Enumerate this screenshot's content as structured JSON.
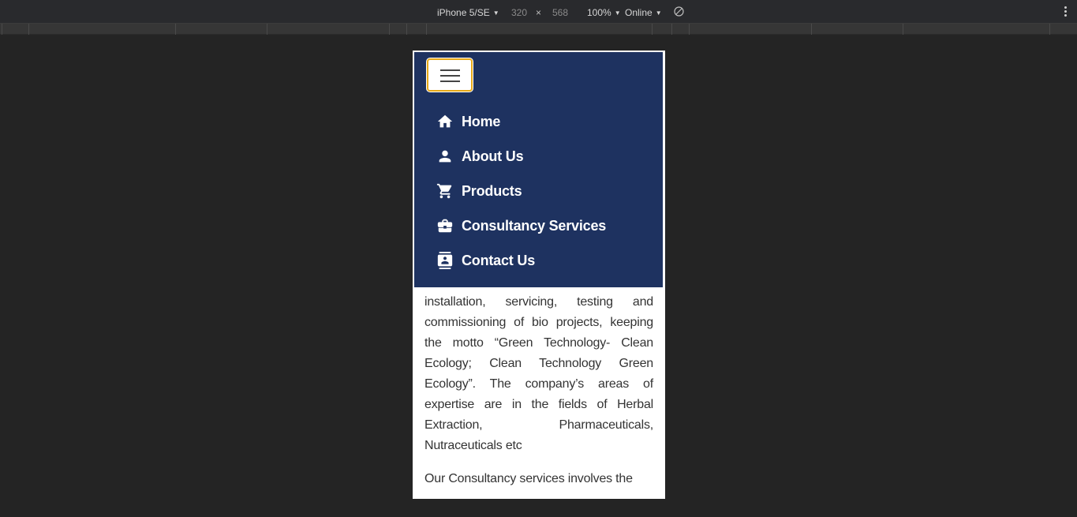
{
  "devtools": {
    "device": "iPhone 5/SE",
    "width": "320",
    "times": "×",
    "height": "568",
    "zoom": "100%",
    "network": "Online",
    "icons": {
      "dropdown": "caret-down-icon",
      "rotate": "rotate-icon",
      "more": "more-vertical-icon"
    }
  },
  "nav": {
    "toggler_icon": "hamburger-menu-icon",
    "items": [
      {
        "label": "Home",
        "icon": "home-icon"
      },
      {
        "label": "About Us",
        "icon": "person-icon"
      },
      {
        "label": "Products",
        "icon": "cart-icon"
      },
      {
        "label": "Consultancy Services",
        "icon": "briefcase-icon"
      },
      {
        "label": "Contact Us",
        "icon": "contact-card-icon"
      }
    ]
  },
  "content": {
    "paragraph1": "design, fabrication, supply, construction, installation, servicing, testing and commissioning of bio projects, keeping the motto “Green Technology- Clean Ecology; Clean Technology Green Ecology”. The company’s areas of expertise are in the fields of Herbal Extraction, Pharmaceuticals, Nutraceuticals etc",
    "paragraph2": "Our Consultancy services involves the"
  },
  "colors": {
    "nav_bg": "#1e3260",
    "toggler_border": "#e6a817",
    "devtools_bg": "#292a2d",
    "page_bg": "#242424"
  }
}
